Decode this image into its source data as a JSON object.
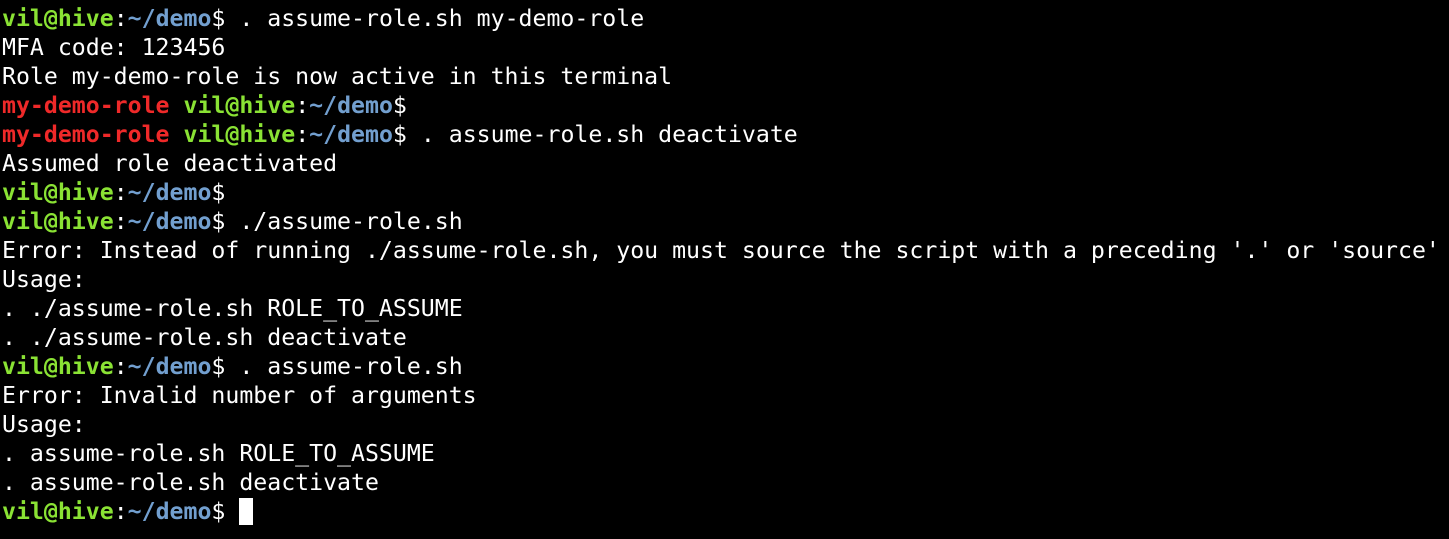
{
  "colors": {
    "background": "#000000",
    "text": "#ffffff",
    "user_host": "#8ae234",
    "path": "#729fcf",
    "role": "#ef2929",
    "cursor": "#ffffff"
  },
  "terminal": {
    "lines": [
      [
        {
          "t": "vil@hive",
          "c": "user_host",
          "b": true
        },
        {
          "t": ":",
          "c": "text"
        },
        {
          "t": "~/demo",
          "c": "path",
          "b": true
        },
        {
          "t": "$ . assume-role.sh my-demo-role",
          "c": "text"
        }
      ],
      [
        {
          "t": "MFA code: 123456",
          "c": "text"
        }
      ],
      [
        {
          "t": "Role my-demo-role is now active in this terminal",
          "c": "text"
        }
      ],
      [
        {
          "t": "my-demo-role",
          "c": "role",
          "b": true
        },
        {
          "t": " ",
          "c": "text"
        },
        {
          "t": "vil@hive",
          "c": "user_host",
          "b": true
        },
        {
          "t": ":",
          "c": "text"
        },
        {
          "t": "~/demo",
          "c": "path",
          "b": true
        },
        {
          "t": "$",
          "c": "text"
        }
      ],
      [
        {
          "t": "my-demo-role",
          "c": "role",
          "b": true
        },
        {
          "t": " ",
          "c": "text"
        },
        {
          "t": "vil@hive",
          "c": "user_host",
          "b": true
        },
        {
          "t": ":",
          "c": "text"
        },
        {
          "t": "~/demo",
          "c": "path",
          "b": true
        },
        {
          "t": "$ . assume-role.sh deactivate",
          "c": "text"
        }
      ],
      [
        {
          "t": "Assumed role deactivated",
          "c": "text"
        }
      ],
      [
        {
          "t": "vil@hive",
          "c": "user_host",
          "b": true
        },
        {
          "t": ":",
          "c": "text"
        },
        {
          "t": "~/demo",
          "c": "path",
          "b": true
        },
        {
          "t": "$",
          "c": "text"
        }
      ],
      [
        {
          "t": "vil@hive",
          "c": "user_host",
          "b": true
        },
        {
          "t": ":",
          "c": "text"
        },
        {
          "t": "~/demo",
          "c": "path",
          "b": true
        },
        {
          "t": "$ ./assume-role.sh",
          "c": "text"
        }
      ],
      [
        {
          "t": "Error: Instead of running ./assume-role.sh, you must source the script with a preceding '.' or 'source'",
          "c": "text"
        }
      ],
      [
        {
          "t": "Usage:",
          "c": "text"
        }
      ],
      [
        {
          "t": ". ./assume-role.sh ROLE_TO_ASSUME",
          "c": "text"
        }
      ],
      [
        {
          "t": ". ./assume-role.sh deactivate",
          "c": "text"
        }
      ],
      [
        {
          "t": "vil@hive",
          "c": "user_host",
          "b": true
        },
        {
          "t": ":",
          "c": "text"
        },
        {
          "t": "~/demo",
          "c": "path",
          "b": true
        },
        {
          "t": "$ . assume-role.sh",
          "c": "text"
        }
      ],
      [
        {
          "t": "Error: Invalid number of arguments",
          "c": "text"
        }
      ],
      [
        {
          "t": "Usage:",
          "c": "text"
        }
      ],
      [
        {
          "t": ". assume-role.sh ROLE_TO_ASSUME",
          "c": "text"
        }
      ],
      [
        {
          "t": ". assume-role.sh deactivate",
          "c": "text"
        }
      ],
      [
        {
          "t": "vil@hive",
          "c": "user_host",
          "b": true
        },
        {
          "t": ":",
          "c": "text"
        },
        {
          "t": "~/demo",
          "c": "path",
          "b": true
        },
        {
          "t": "$ ",
          "c": "text"
        },
        {
          "cursor": true
        }
      ]
    ]
  }
}
